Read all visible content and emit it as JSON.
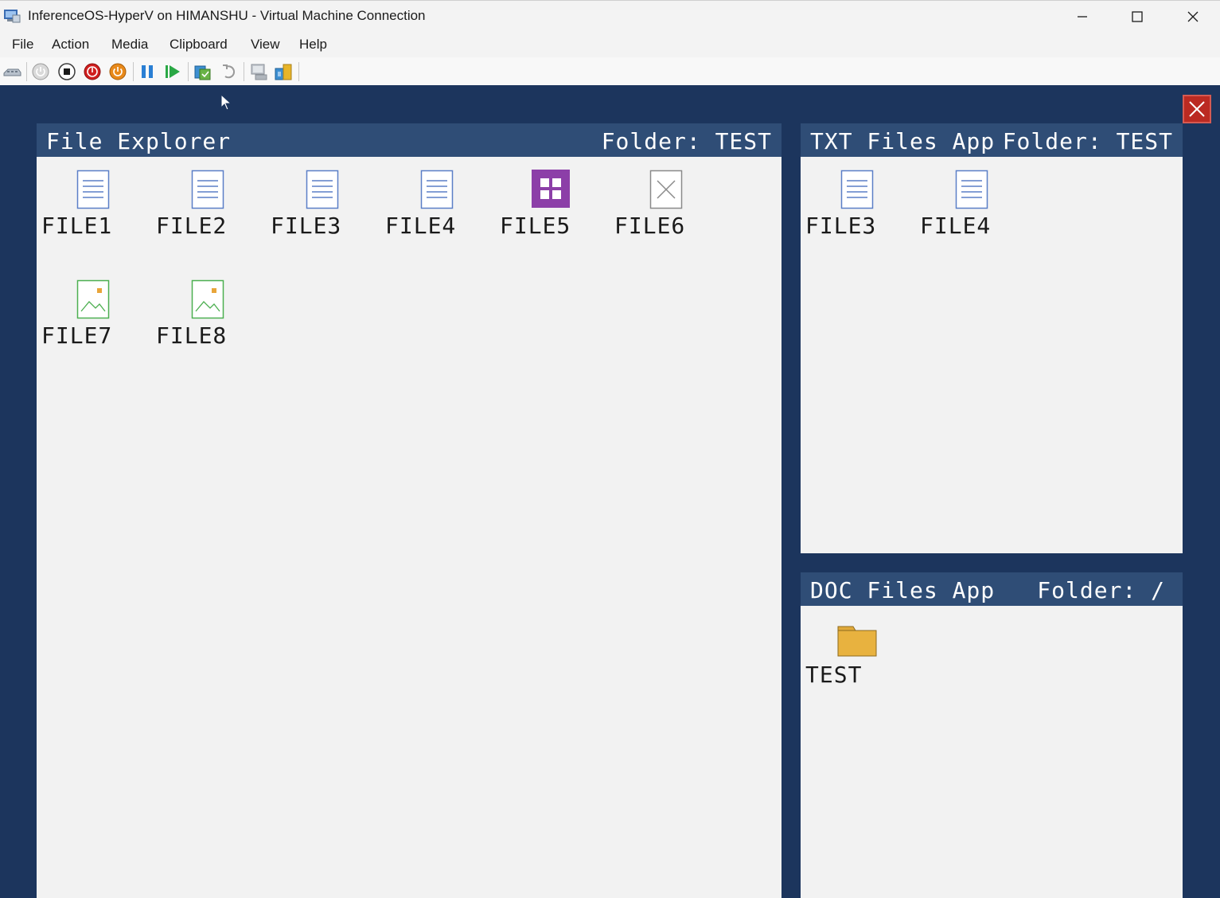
{
  "window": {
    "title": "InferenceOS-HyperV on HIMANSHU - Virtual Machine Connection"
  },
  "menu": [
    "File",
    "Action",
    "Media",
    "Clipboard",
    "View",
    "Help"
  ],
  "toolbar": {
    "icons": [
      "ctrl-alt-del-icon",
      "start-icon",
      "turn-off-icon",
      "shut-down-icon",
      "save-state-icon",
      "pause-icon",
      "resume-icon",
      "checkpoint-icon",
      "revert-icon",
      "enhanced-session-icon",
      "share-icon"
    ]
  },
  "file_explorer": {
    "title": "File Explorer",
    "folder": "Folder: TEST",
    "files": [
      {
        "name": "FILE1",
        "type": "text"
      },
      {
        "name": "FILE2",
        "type": "text"
      },
      {
        "name": "FILE3",
        "type": "text"
      },
      {
        "name": "FILE4",
        "type": "text"
      },
      {
        "name": "FILE5",
        "type": "app"
      },
      {
        "name": "FILE6",
        "type": "unknown"
      },
      {
        "name": "FILE7",
        "type": "image"
      },
      {
        "name": "FILE8",
        "type": "image"
      }
    ]
  },
  "txt_app": {
    "title": "TXT Files App",
    "folder": "Folder: TEST",
    "files": [
      {
        "name": "FILE3",
        "type": "text"
      },
      {
        "name": "FILE4",
        "type": "text"
      }
    ]
  },
  "doc_app": {
    "title": "DOC Files App",
    "folder": "Folder: /",
    "files": [
      {
        "name": "TEST",
        "type": "folder"
      }
    ]
  },
  "colors": {
    "guest_background": "#1c355d",
    "panel_header": "#2f4d76",
    "panel_body": "#f2f2f2",
    "close_red": "#bb2a22",
    "text_icon": "#5b7fc7",
    "app_icon": "#8c3fa8",
    "image_icon": "#4caf50",
    "folder": "#e0a93a"
  }
}
